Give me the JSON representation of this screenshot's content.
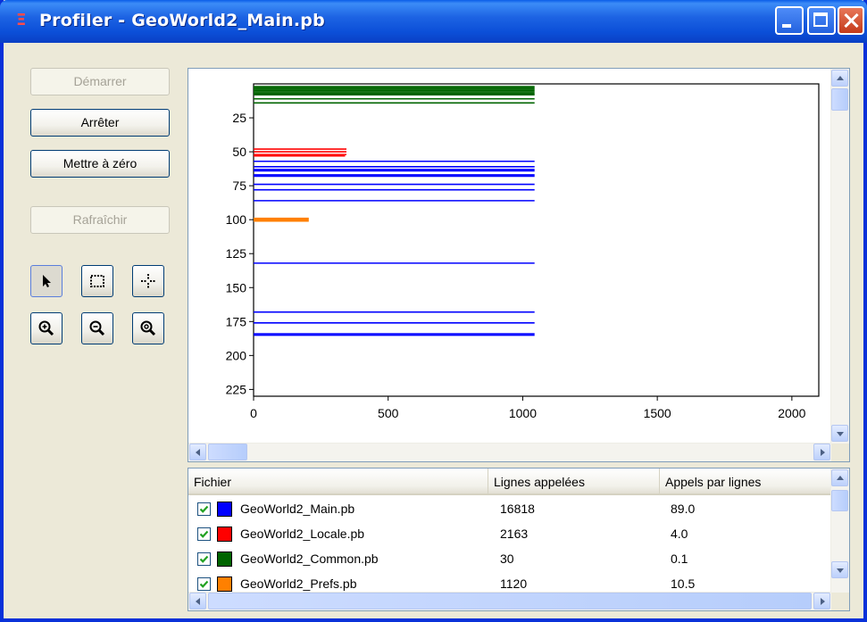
{
  "window": {
    "title": "Profiler - GeoWorld2_Main.pb",
    "title_icon": "profiler-icon"
  },
  "buttons": {
    "start": "Démarrer",
    "stop": "Arrêter",
    "reset": "Mettre à zéro",
    "refresh": "Rafraîchir"
  },
  "tools": [
    {
      "name": "select-arrow-icon",
      "active": true
    },
    {
      "name": "selection-rectangle-icon",
      "active": false
    },
    {
      "name": "crosshair-icon",
      "active": false
    },
    {
      "name": "zoom-in-icon",
      "active": false
    },
    {
      "name": "zoom-out-icon",
      "active": false
    },
    {
      "name": "zoom-reset-icon",
      "active": false
    }
  ],
  "chart_data": {
    "type": "bar",
    "orientation": "horizontal",
    "xlim": [
      0,
      2100
    ],
    "ylim": [
      0,
      230
    ],
    "x_ticks": [
      0,
      500,
      1000,
      1500,
      2000
    ],
    "y_ticks": [
      25,
      50,
      75,
      100,
      125,
      150,
      175,
      200,
      225
    ],
    "series": [
      {
        "file": "GeoWorld2_Main.pb",
        "color": "#0000ff",
        "lines": [
          [
            57,
            1044
          ],
          [
            61,
            1044
          ],
          [
            63,
            1044
          ],
          [
            64,
            1044
          ],
          [
            67,
            1044
          ],
          [
            68,
            1044
          ],
          [
            74,
            1044
          ],
          [
            78,
            1044
          ],
          [
            86,
            1044
          ],
          [
            132,
            1044
          ],
          [
            168,
            1044
          ],
          [
            176,
            1044
          ],
          [
            184,
            1044
          ],
          [
            185,
            1044
          ]
        ]
      },
      {
        "file": "GeoWorld2_Locale.pb",
        "color": "#ff0000",
        "lines": [
          [
            48,
            345
          ],
          [
            50,
            345
          ],
          [
            52,
            345
          ],
          [
            53,
            340
          ]
        ]
      },
      {
        "file": "GeoWorld2_Common.pb",
        "color": "#006400",
        "lines": [
          [
            2,
            1044
          ],
          [
            3,
            1044
          ],
          [
            4,
            1044
          ],
          [
            5,
            1044
          ],
          [
            6,
            1044
          ],
          [
            7,
            1044
          ],
          [
            8,
            1044
          ],
          [
            11,
            1044
          ],
          [
            14,
            1044
          ]
        ]
      },
      {
        "file": "GeoWorld2_Prefs.pb",
        "color": "#ff8000",
        "lines": [
          [
            99,
            205
          ],
          [
            100,
            205
          ],
          [
            101,
            205
          ]
        ]
      }
    ]
  },
  "list": {
    "columns": [
      "Fichier",
      "Lignes appelées",
      "Appels par lignes"
    ],
    "rows": [
      {
        "checked": true,
        "color": "#0000ff",
        "file": "GeoWorld2_Main.pb",
        "lines": "16818",
        "calls": "89.0"
      },
      {
        "checked": true,
        "color": "#ff0000",
        "file": "GeoWorld2_Locale.pb",
        "lines": "2163",
        "calls": "4.0"
      },
      {
        "checked": true,
        "color": "#006400",
        "file": "GeoWorld2_Common.pb",
        "lines": "30",
        "calls": "0.1"
      },
      {
        "checked": true,
        "color": "#ff8000",
        "file": "GeoWorld2_Prefs.pb",
        "lines": "1120",
        "calls": "10.5"
      }
    ]
  }
}
